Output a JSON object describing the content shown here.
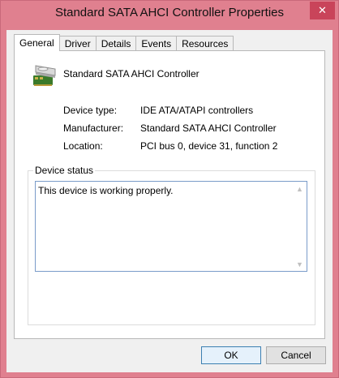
{
  "window": {
    "title": "Standard SATA AHCI Controller Properties",
    "close_glyph": "✕"
  },
  "tabs": [
    {
      "label": "General"
    },
    {
      "label": "Driver"
    },
    {
      "label": "Details"
    },
    {
      "label": "Events"
    },
    {
      "label": "Resources"
    }
  ],
  "device": {
    "name": "Standard SATA AHCI Controller",
    "icon": "storage-controller-icon",
    "properties": [
      {
        "label": "Device type:",
        "value": "IDE ATA/ATAPI controllers"
      },
      {
        "label": "Manufacturer:",
        "value": "Standard SATA AHCI Controller"
      },
      {
        "label": "Location:",
        "value": "PCI bus 0, device 31, function 2"
      }
    ]
  },
  "device_status": {
    "legend": "Device status",
    "text": "This device is working properly."
  },
  "buttons": {
    "ok": "OK",
    "cancel": "Cancel"
  },
  "colors": {
    "title_bar": "#e0808f",
    "close_button": "#c9445a",
    "focus_border": "#7a9cc9"
  }
}
